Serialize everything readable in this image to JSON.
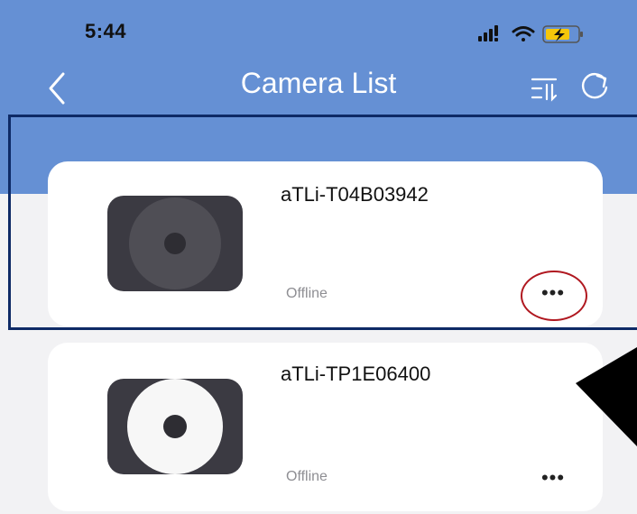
{
  "status_bar": {
    "time": "5:44",
    "icons": [
      "signal-icon",
      "wifi-icon",
      "battery-charging-icon"
    ]
  },
  "nav": {
    "title": "Camera List",
    "back_icon": "chevron-left-icon",
    "sort_icon": "sort-icon",
    "refresh_icon": "refresh-icon"
  },
  "cameras": [
    {
      "name": "aTLi-T04B03942",
      "status": "Offline",
      "more_label": "•••"
    },
    {
      "name": "aTLi-TP1E06400",
      "status": "Offline",
      "more_label": "•••"
    }
  ],
  "colors": {
    "header": "#6590d4",
    "background": "#f2f2f4",
    "card": "#ffffff",
    "thumb": "#3b3a42",
    "status_text": "#8e8e93",
    "highlight_box": "#0e2a66",
    "highlight_circle": "#b01820",
    "battery": "#f5c60a"
  }
}
